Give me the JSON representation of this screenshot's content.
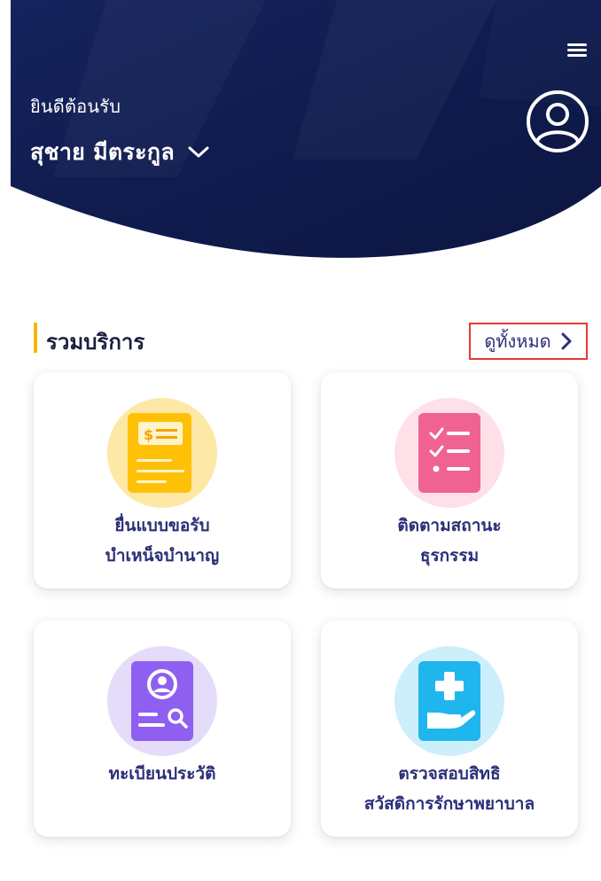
{
  "header": {
    "greeting": "ยินดีต้อนรับ",
    "user_name": "สุชาย มีตระกูล",
    "menu_icon": "hamburger-menu-icon",
    "profile_icon": "user-profile-icon",
    "bg_color": "#0f1b4d"
  },
  "services": {
    "title": "รวมบริการ",
    "view_all_label": "ดูทั้งหมด",
    "accent_color": "#f5b800",
    "items": [
      {
        "line1": "ยื่นแบบขอรับ",
        "line2": "บำเหน็จบำนาญ",
        "icon": "pension-form-icon"
      },
      {
        "line1": "ติดตามสถานะ",
        "line2": "ธุรกรรม",
        "icon": "checklist-icon"
      },
      {
        "line1": "ทะเบียนประวัติ",
        "line2": "",
        "icon": "profile-record-search-icon"
      },
      {
        "line1": "ตรวจสอบสิทธิ",
        "line2": "สวัสดิการรักษาพยาบาล",
        "icon": "medical-welfare-icon"
      }
    ]
  }
}
